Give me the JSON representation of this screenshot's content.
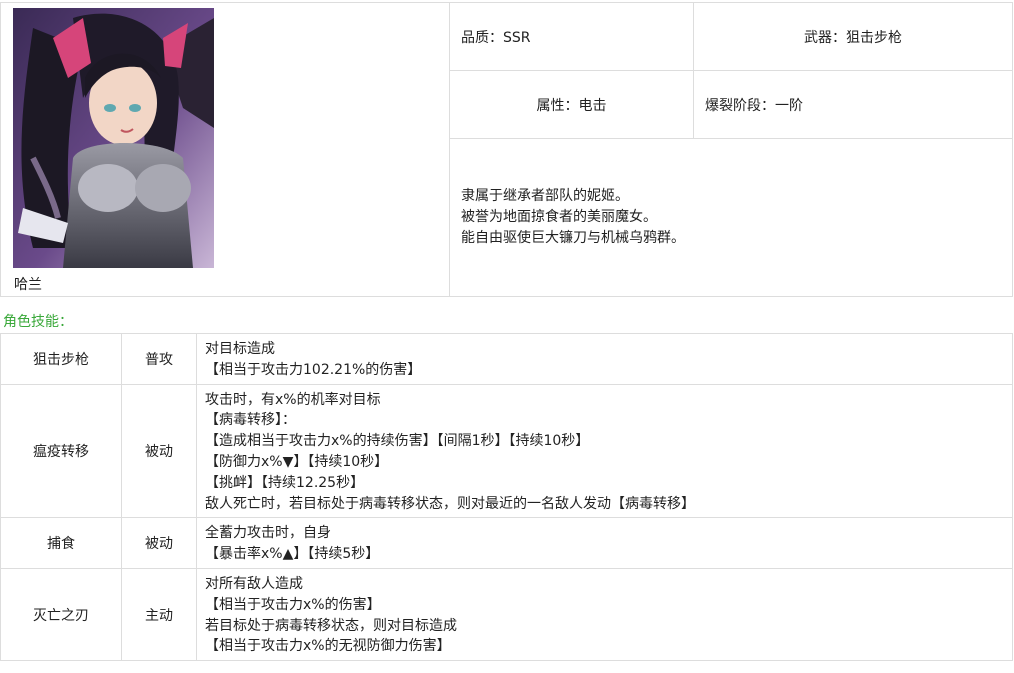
{
  "character": {
    "name": "哈兰",
    "quality": "品质：SSR",
    "weapon": "武器：狙击步枪",
    "attribute": "属性：电击",
    "burst_stage": "爆裂阶段：一阶",
    "description": [
      "隶属于继承者部队的妮姬。",
      "被誉为地面掠食者的美丽魔女。",
      "能自由驱使巨大镰刀与机械乌鸦群。"
    ]
  },
  "skills_heading": "角色技能：",
  "skills": [
    {
      "name": "狙击步枪",
      "type": "普攻",
      "lines": [
        "对目标造成",
        "【相当于攻击力102.21%的伤害】"
      ]
    },
    {
      "name": "瘟疫转移",
      "type": "被动",
      "lines": [
        "攻击时，有x%的机率对目标",
        "【病毒转移】：",
        "【造成相当于攻击力x%的持续伤害】【间隔1秒】【持续10秒】",
        "【防御力x%▼】【持续10秒】",
        "【挑衅】【持续12.25秒】",
        "敌人死亡时，若目标处于病毒转移状态，则对最近的一名敌人发动【病毒转移】"
      ]
    },
    {
      "name": "捕食",
      "type": "被动",
      "lines": [
        "全蓄力攻击时，自身",
        "【暴击率x%▲】【持续5秒】"
      ]
    },
    {
      "name": "灭亡之刃",
      "type": "主动",
      "lines": [
        "对所有敌人造成",
        "【相当于攻击力x%的伤害】",
        "若目标处于病毒转移状态，则对目标造成",
        "【相当于攻击力x%的无视防御力伤害】"
      ]
    }
  ]
}
